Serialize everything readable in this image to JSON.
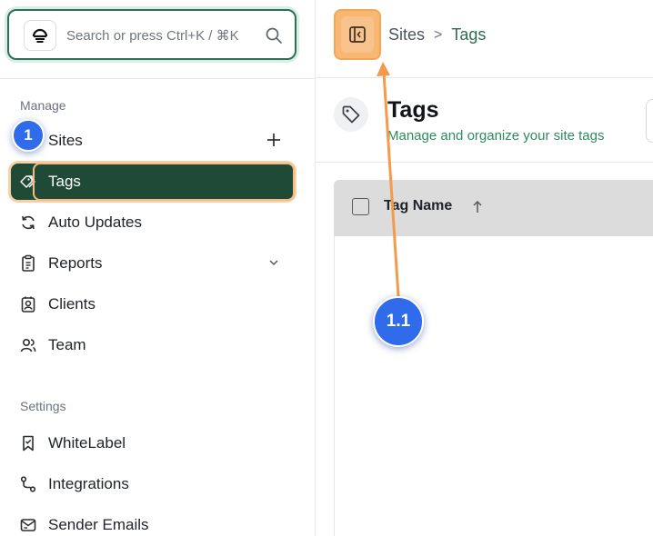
{
  "search": {
    "placeholder": "Search or press Ctrl+K / ⌘K",
    "value": "",
    "icon": "search-icon"
  },
  "brand": {
    "icon": "logo-icon"
  },
  "sidebar": {
    "sections": [
      {
        "label": "Manage",
        "items": [
          {
            "label": "Sites",
            "icon": "globe-icon",
            "trailing": "plus-icon",
            "active": false
          },
          {
            "label": "Tags",
            "icon": "tags-icon",
            "active": true
          },
          {
            "label": "Auto Updates",
            "icon": "refresh-icon",
            "active": false
          },
          {
            "label": "Reports",
            "icon": "report-icon",
            "trailing": "chevron-down-icon",
            "active": false
          },
          {
            "label": "Clients",
            "icon": "contact-icon",
            "active": false
          },
          {
            "label": "Team",
            "icon": "users-icon",
            "active": false
          }
        ]
      },
      {
        "label": "Settings",
        "items": [
          {
            "label": "WhiteLabel",
            "icon": "bookmark-icon"
          },
          {
            "label": "Integrations",
            "icon": "route-icon"
          },
          {
            "label": "Sender Emails",
            "icon": "mail-icon"
          }
        ]
      }
    ]
  },
  "header": {
    "toggle_icon": "sidebar-collapse-icon",
    "breadcrumb": {
      "parent": "Sites",
      "separator": ">",
      "current": "Tags"
    }
  },
  "page": {
    "icon": "tag-icon",
    "title": "Tags",
    "subtitle": "Manage and organize your site tags"
  },
  "table": {
    "columns": [
      {
        "label": "Tag Name",
        "sort": "ascending",
        "sort_icon": "arrow-up-icon"
      }
    ],
    "rows": []
  },
  "annotations": {
    "steps": [
      "1",
      "1.1"
    ],
    "colors": {
      "badge": "#2f6bea",
      "arrow": "#f59a4a",
      "highlight": "#f9b872",
      "active_nav": "#1f4a35"
    }
  }
}
